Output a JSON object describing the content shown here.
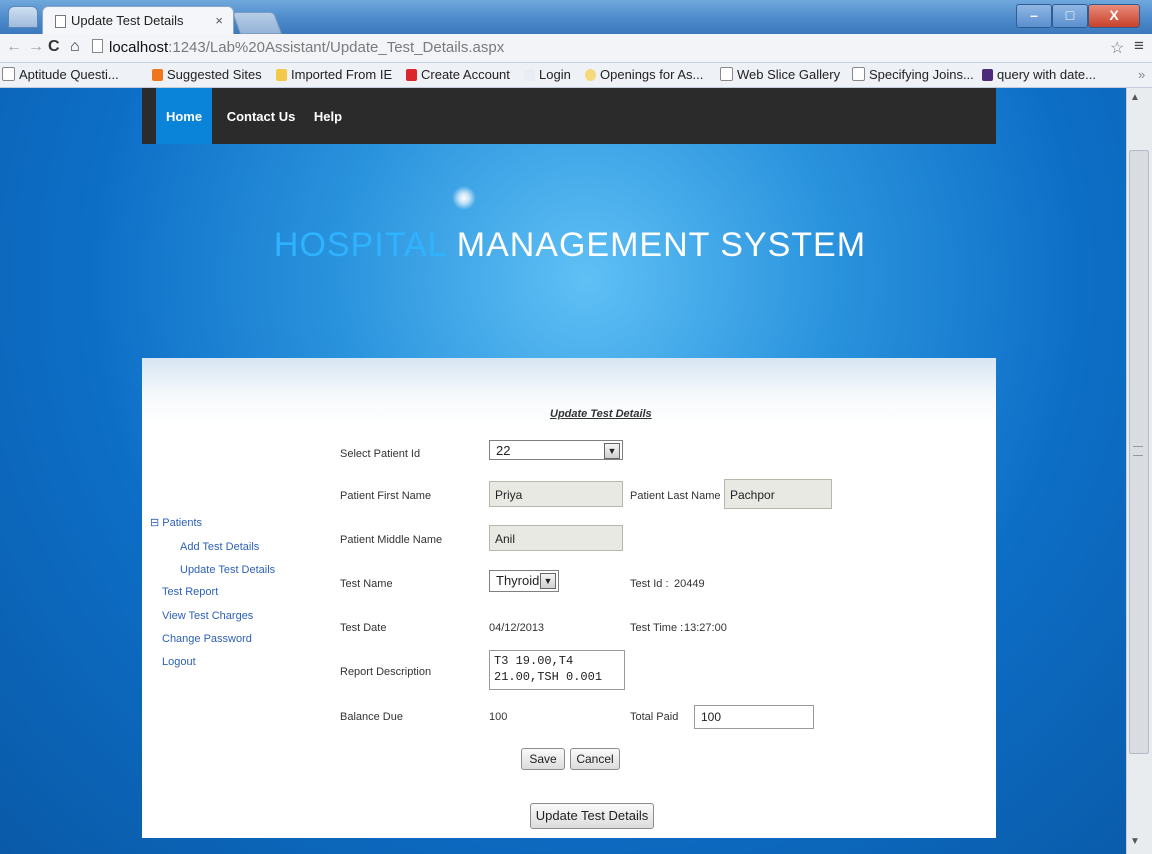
{
  "browser": {
    "tab_title": "Update Test Details",
    "tab_close": "×",
    "url_host": "localhost",
    "url_rest": ":1243/Lab%20Assistant/Update_Test_Details.aspx",
    "bookmarks": [
      "Aptitude Questi...",
      "Suggested Sites",
      "Imported From IE",
      "Create Account",
      "Login",
      "Openings for As...",
      "Web Slice Gallery",
      "Specifying Joins...",
      "query with date..."
    ]
  },
  "site": {
    "nav": {
      "home": "Home",
      "contact": "Contact Us",
      "help": "Help"
    },
    "banner": {
      "part1": "HOSPITAL",
      "part2": "MANAGEMENT SYSTEM"
    }
  },
  "sidebar": {
    "root": "⊟ Patients",
    "items": [
      "Add Test Details",
      "Update Test Details",
      "Test Report",
      "View Test Charges",
      "Change Password",
      "Logout"
    ]
  },
  "form": {
    "heading": "Update Test Details",
    "labels": {
      "patient_id": "Select Patient Id",
      "first_name": "Patient First Name",
      "last_name": "Patient Last Name",
      "middle_name": "Patient Middle Name",
      "test_name": "Test Name",
      "test_id": "Test Id :",
      "test_date": "Test Date",
      "test_time": "Test Time :",
      "report_desc": "Report Description",
      "balance_due": "Balance Due",
      "total_paid": "Total Paid"
    },
    "values": {
      "patient_id": "22",
      "first_name": "Priya",
      "last_name": "Pachpor",
      "middle_name": "Anil",
      "test_name": "Thyroide",
      "test_id": "20449",
      "test_date": "04/12/2013",
      "test_time": "13:27:00",
      "report_desc": "T3 19.00,T4\n21.00,TSH 0.001",
      "balance_due": "100",
      "total_paid": "100"
    },
    "buttons": {
      "save": "Save",
      "cancel": "Cancel",
      "update": "Update Test Details"
    }
  },
  "colors": {
    "nav_active": "#0a84d8",
    "banner_accent": "#2fb3ff",
    "link": "#2d61b5"
  }
}
